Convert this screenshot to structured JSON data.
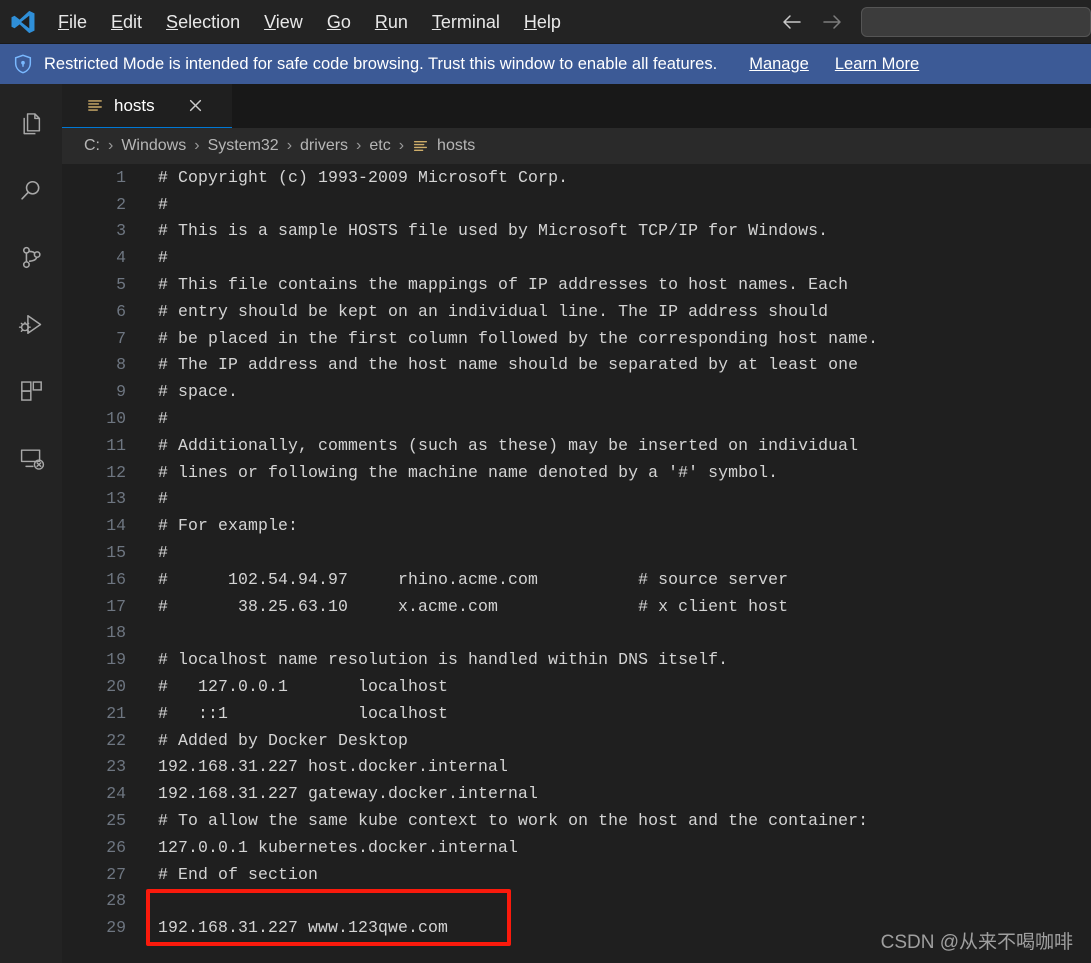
{
  "window": {
    "logo": "vscode-logo"
  },
  "menubar": {
    "items": [
      {
        "label": "File",
        "mnemonic": "F"
      },
      {
        "label": "Edit",
        "mnemonic": "E"
      },
      {
        "label": "Selection",
        "mnemonic": "S"
      },
      {
        "label": "View",
        "mnemonic": "V"
      },
      {
        "label": "Go",
        "mnemonic": "G"
      },
      {
        "label": "Run",
        "mnemonic": "R"
      },
      {
        "label": "Terminal",
        "mnemonic": "T"
      },
      {
        "label": "Help",
        "mnemonic": "H"
      }
    ]
  },
  "titlebar_nav": {
    "back_icon": "arrow-left-icon",
    "forward_icon": "arrow-right-icon"
  },
  "command_center": {
    "value": "",
    "placeholder": ""
  },
  "banner": {
    "icon": "shield-lock-icon",
    "message": "Restricted Mode is intended for safe code browsing. Trust this window to enable all features.",
    "links": [
      {
        "label": "Manage"
      },
      {
        "label": "Learn More"
      }
    ],
    "background_color": "#3c5a96"
  },
  "activitybar": {
    "items": [
      {
        "name": "explorer",
        "icon": "files-icon",
        "label": "Explorer"
      },
      {
        "name": "search",
        "icon": "search-icon",
        "label": "Search"
      },
      {
        "name": "source-control",
        "icon": "source-control-icon",
        "label": "Source Control"
      },
      {
        "name": "run-debug",
        "icon": "run-and-debug-icon",
        "label": "Run and Debug"
      },
      {
        "name": "extensions",
        "icon": "extensions-icon",
        "label": "Extensions"
      },
      {
        "name": "remote",
        "icon": "remote-explorer-icon",
        "label": "Remote Explorer"
      }
    ]
  },
  "editor": {
    "tab": {
      "icon": "text-file-icon",
      "label": "hosts",
      "close_icon": "close-icon",
      "active_border_color": "#0078d4"
    },
    "breadcrumb": {
      "segments": [
        "C:",
        "Windows",
        "System32",
        "drivers",
        "etc"
      ],
      "separator": "›",
      "file_icon": "text-file-icon",
      "file": "hosts"
    },
    "lines": [
      {
        "n": "1",
        "text": "# Copyright (c) 1993-2009 Microsoft Corp."
      },
      {
        "n": "2",
        "text": "#"
      },
      {
        "n": "3",
        "text": "# This is a sample HOSTS file used by Microsoft TCP/IP for Windows."
      },
      {
        "n": "4",
        "text": "#"
      },
      {
        "n": "5",
        "text": "# This file contains the mappings of IP addresses to host names. Each"
      },
      {
        "n": "6",
        "text": "# entry should be kept on an individual line. The IP address should"
      },
      {
        "n": "7",
        "text": "# be placed in the first column followed by the corresponding host name."
      },
      {
        "n": "8",
        "text": "# The IP address and the host name should be separated by at least one"
      },
      {
        "n": "9",
        "text": "# space."
      },
      {
        "n": "10",
        "text": "#"
      },
      {
        "n": "11",
        "text": "# Additionally, comments (such as these) may be inserted on individual"
      },
      {
        "n": "12",
        "text": "# lines or following the machine name denoted by a '#' symbol."
      },
      {
        "n": "13",
        "text": "#"
      },
      {
        "n": "14",
        "text": "# For example:"
      },
      {
        "n": "15",
        "text": "#"
      },
      {
        "n": "16",
        "text": "#      102.54.94.97     rhino.acme.com          # source server"
      },
      {
        "n": "17",
        "text": "#       38.25.63.10     x.acme.com              # x client host"
      },
      {
        "n": "18",
        "text": ""
      },
      {
        "n": "19",
        "text": "# localhost name resolution is handled within DNS itself."
      },
      {
        "n": "20",
        "text": "#   127.0.0.1       localhost"
      },
      {
        "n": "21",
        "text": "#   ::1             localhost"
      },
      {
        "n": "22",
        "text": "# Added by Docker Desktop"
      },
      {
        "n": "23",
        "text": "192.168.31.227 host.docker.internal"
      },
      {
        "n": "24",
        "text": "192.168.31.227 gateway.docker.internal"
      },
      {
        "n": "25",
        "text": "# To allow the same kube context to work on the host and the container:"
      },
      {
        "n": "26",
        "text": "127.0.0.1 kubernetes.docker.internal"
      },
      {
        "n": "27",
        "text": "# End of section"
      },
      {
        "n": "28",
        "text": ""
      },
      {
        "n": "29",
        "text": "192.168.31.227 www.123qwe.com"
      }
    ]
  },
  "annotation": {
    "color": "#fa1a0c",
    "target_line": "29"
  },
  "watermark": {
    "text": "CSDN @从来不喝咖啡"
  }
}
